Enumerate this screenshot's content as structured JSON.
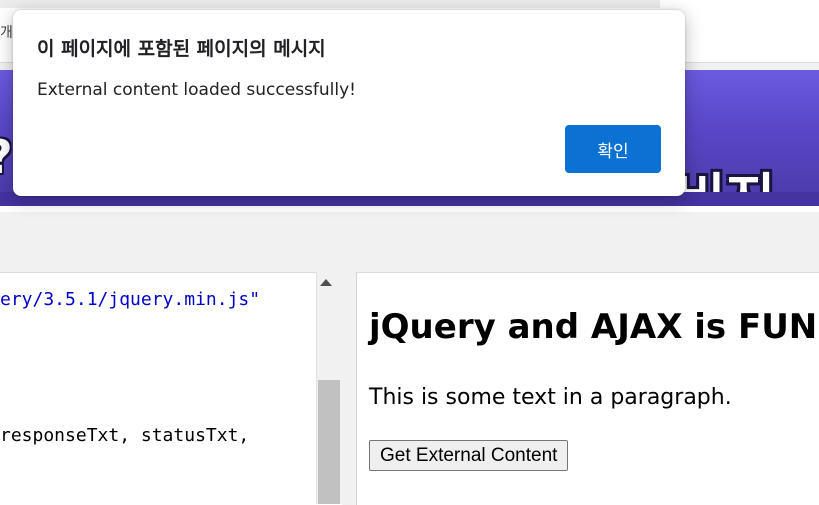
{
  "background_page": {
    "tab_text": "개",
    "banner": {
      "left_text": "?",
      "right_text": "비지",
      "colors": {
        "top": "#6b5be0",
        "bottom": "#4a3aa8"
      }
    }
  },
  "code_editor": {
    "lines": [
      {
        "text": "ery/3.5.1/jquery.min.js\"",
        "color": "#0000c8"
      },
      {
        "text": "responseTxt, statusTxt,",
        "color": "#000000"
      }
    ]
  },
  "result": {
    "heading": "jQuery and AJAX is FUN!",
    "paragraph": "This is some text in a paragraph.",
    "button_label": "Get External Content"
  },
  "dialog": {
    "title": "이 페이지에 포함된 페이지의 메시지",
    "message": "External content loaded successfully!",
    "ok_label": "확인",
    "ok_color": "#0b72d4"
  }
}
